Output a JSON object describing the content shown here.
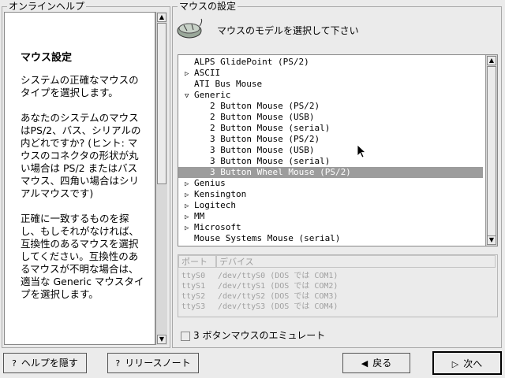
{
  "help": {
    "frame_title": "オンラインヘルプ",
    "title": "マウス設定",
    "paragraphs": [
      "システムの正確なマウスのタイプを選択します。",
      "あなたのシステムのマウスはPS/2、バス、シリアルの内どれですか? (ヒント: マウスのコネクタの形状が丸い場合は PS/2 またはバスマウス、四角い場合はシリアルマウスです)",
      "正確に一致するものを探し、もしそれがなければ、互換性のあるマウスを選択してください。互換性のあるマウスが不明な場合は、適当な Generic マウスタイプを選択します。"
    ]
  },
  "mouse": {
    "frame_title": "マウスの設定",
    "icon": "mouse-icon",
    "instruction": "マウスのモデルを選択して下さい",
    "tree": [
      {
        "label": "ALPS GlidePoint (PS/2)",
        "level": 0,
        "expander": "none"
      },
      {
        "label": "ASCII",
        "level": 0,
        "expander": "collapsed"
      },
      {
        "label": "ATI Bus Mouse",
        "level": 0,
        "expander": "none"
      },
      {
        "label": "Generic",
        "level": 0,
        "expander": "expanded"
      },
      {
        "label": "2 Button Mouse (PS/2)",
        "level": 1,
        "expander": "none"
      },
      {
        "label": "2 Button Mouse (USB)",
        "level": 1,
        "expander": "none"
      },
      {
        "label": "2 Button Mouse (serial)",
        "level": 1,
        "expander": "none"
      },
      {
        "label": "3 Button Mouse (PS/2)",
        "level": 1,
        "expander": "none"
      },
      {
        "label": "3 Button Mouse (USB)",
        "level": 1,
        "expander": "none"
      },
      {
        "label": "3 Button Mouse (serial)",
        "level": 1,
        "expander": "none"
      },
      {
        "label": "3 Button Wheel Mouse (PS/2)",
        "level": 1,
        "expander": "none",
        "selected": true
      },
      {
        "label": "Genius",
        "level": 0,
        "expander": "collapsed"
      },
      {
        "label": "Kensington",
        "level": 0,
        "expander": "collapsed"
      },
      {
        "label": "Logitech",
        "level": 0,
        "expander": "collapsed"
      },
      {
        "label": "MM",
        "level": 0,
        "expander": "collapsed"
      },
      {
        "label": "Microsoft",
        "level": 0,
        "expander": "collapsed"
      },
      {
        "label": "Mouse Systems Mouse (serial)",
        "level": 0,
        "expander": "none"
      }
    ],
    "device_columns": {
      "port": "ポート",
      "device": "デバイス"
    },
    "devices": [
      {
        "port": "ttyS0",
        "device": "/dev/ttyS0 (DOS では COM1)"
      },
      {
        "port": "ttyS1",
        "device": "/dev/ttyS1 (DOS では COM2)"
      },
      {
        "port": "ttyS2",
        "device": "/dev/ttyS2 (DOS では COM3)"
      },
      {
        "port": "ttyS3",
        "device": "/dev/ttyS3 (DOS では COM4)"
      }
    ],
    "emulate_label": "3 ボタンマウスのエミュレート"
  },
  "buttons": {
    "hide_help": "ヘルプを隠す",
    "release_notes": "リリースノート",
    "back": "戻る",
    "next": "次へ"
  },
  "colors": {
    "selected_row": "#9c9c9c",
    "background": "#ebebeb"
  }
}
